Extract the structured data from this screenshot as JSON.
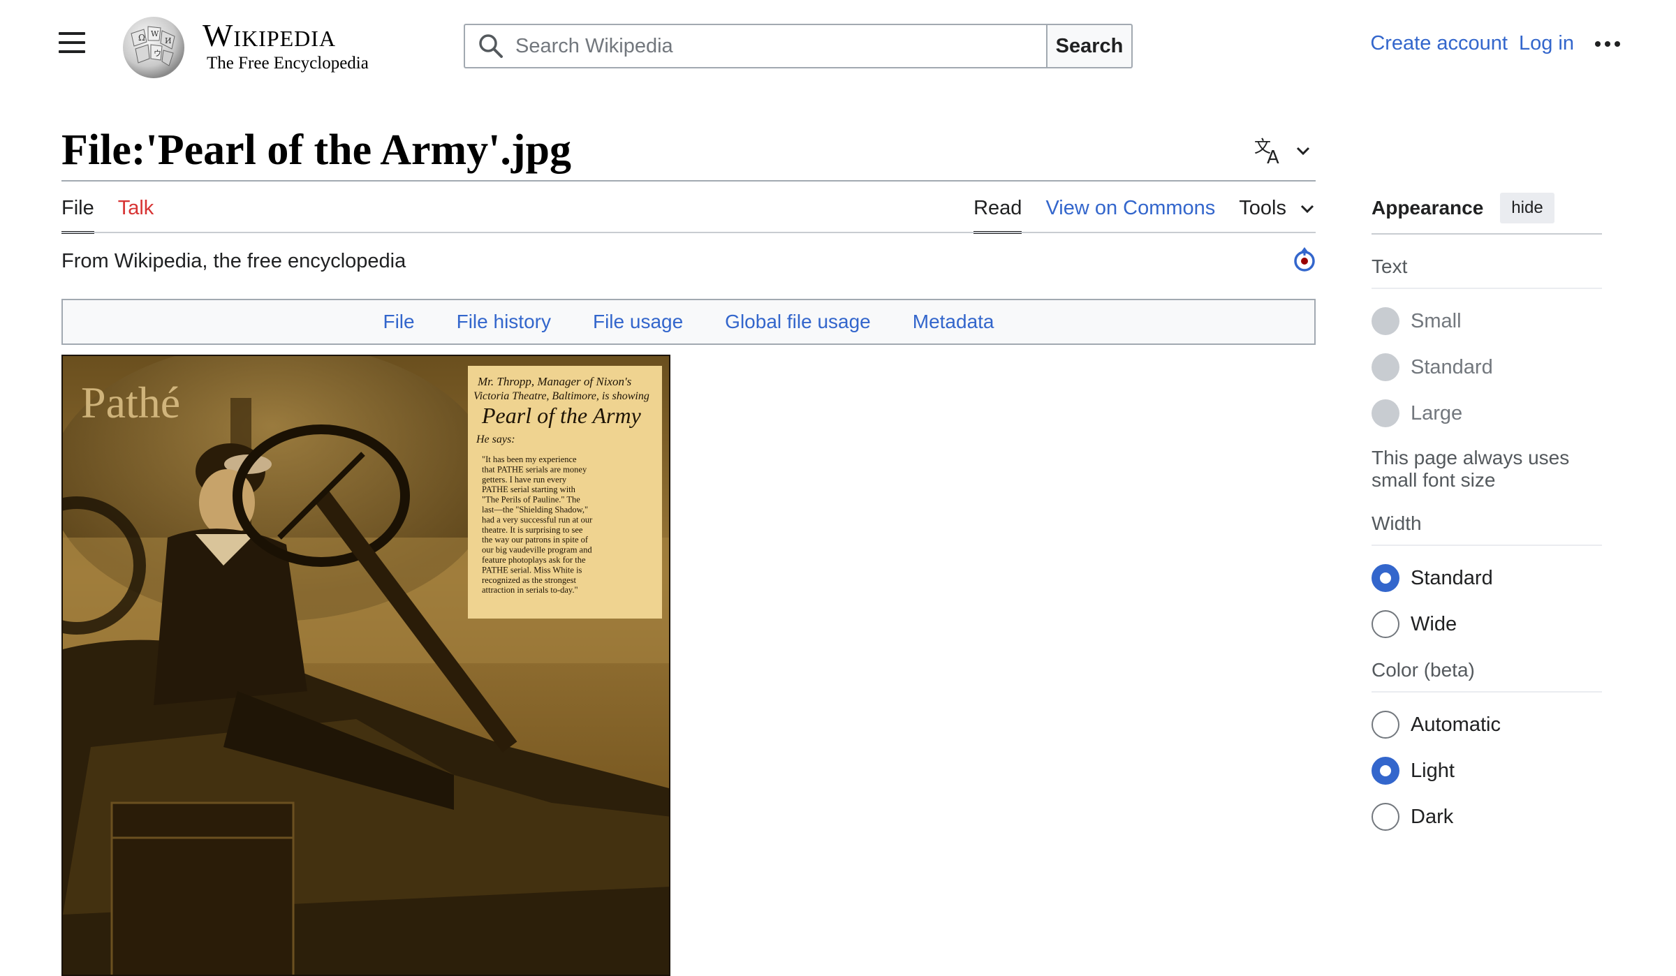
{
  "header": {
    "logo_title": "Wikipedia",
    "logo_tagline": "The Free Encyclopedia",
    "search_placeholder": "Search Wikipedia",
    "search_button": "Search",
    "create_account": "Create account",
    "log_in": "Log in"
  },
  "page": {
    "title": "File:'Pearl of the Army'.jpg",
    "tabs_left": [
      "File",
      "Talk"
    ],
    "tabs_right": {
      "read": "Read",
      "view_on_commons": "View on Commons",
      "tools": "Tools"
    },
    "tagline": "From Wikipedia, the free encyclopedia"
  },
  "file_toc": [
    "File",
    "File history",
    "File usage",
    "Global file usage",
    "Metadata"
  ],
  "image": {
    "brand": "Pathé",
    "clipping_heading_1": "Mr. Thropp, Manager of Nixon's",
    "clipping_heading_2": "Victoria Theatre, Baltimore, is showing",
    "clipping_title": "Pearl of the Army",
    "clipping_says": "He says:",
    "clipping_body": [
      "\"It has been my experience",
      "that PATHE serials are money",
      "getters. I have run every",
      "PATHE serial starting with",
      "\"The Perils of Pauline.\" The",
      "last—the \"Shielding Shadow,\"",
      "had a very successful run at our",
      "theatre. It is surprising to see",
      "the way our patrons in spite of",
      "our big vaudeville program and",
      "feature photoplays ask for the",
      "PATHE serial. Miss White is",
      "recognized as the strongest",
      "attraction in serials to-day.\""
    ]
  },
  "appearance": {
    "title": "Appearance",
    "hide": "hide",
    "text_label": "Text",
    "text_options": [
      "Small",
      "Standard",
      "Large"
    ],
    "text_note": "This page always uses small font size",
    "width_label": "Width",
    "width_options": [
      "Standard",
      "Wide"
    ],
    "width_selected": "Standard",
    "color_label": "Color (beta)",
    "color_options": [
      "Automatic",
      "Light",
      "Dark"
    ],
    "color_selected": "Light"
  },
  "colors": {
    "link": "#3366cc",
    "talk_red": "#d73333",
    "border": "#a2a9b1",
    "sepia": "#b08a3e"
  }
}
